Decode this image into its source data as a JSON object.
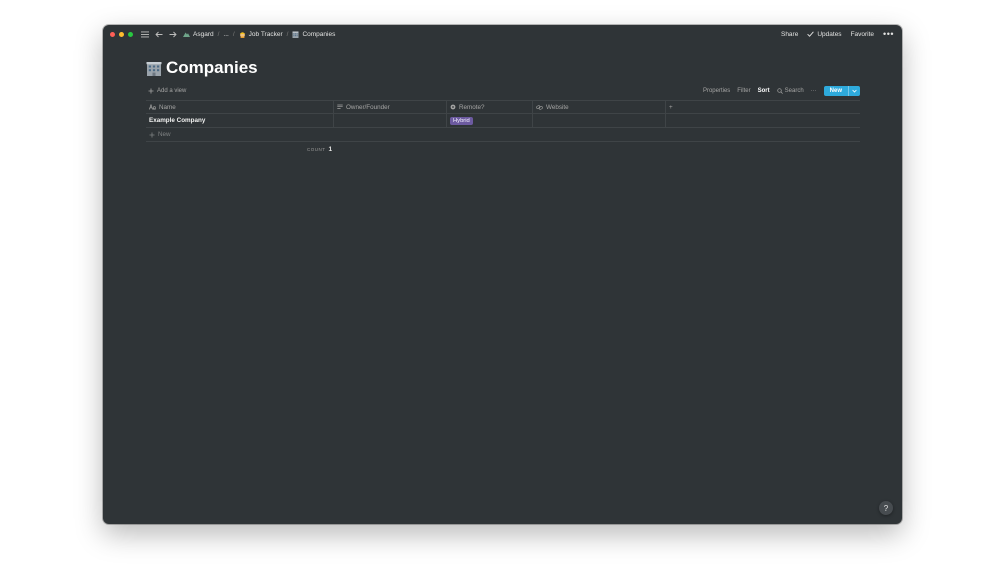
{
  "titlebar": {
    "breadcrumbs": [
      {
        "label": "Asgard",
        "icon": "mountain-icon"
      },
      {
        "label": "...",
        "icon": ""
      },
      {
        "label": "Job Tracker",
        "icon": "worker-emoji-icon"
      },
      {
        "label": "Companies",
        "icon": "office-building-emoji-icon"
      }
    ],
    "separator": "/",
    "share": "Share",
    "updates": "Updates",
    "favorite": "Favorite",
    "more": "•••"
  },
  "page": {
    "title": "Companies",
    "title_icon": "office-building-emoji-icon"
  },
  "viewbar": {
    "add_view": "Add a view",
    "properties": "Properties",
    "filter": "Filter",
    "sort": "Sort",
    "search": "Search",
    "more": "···",
    "new": "New"
  },
  "table": {
    "columns": [
      {
        "label": "Name",
        "icon": "text-aa-icon"
      },
      {
        "label": "Owner/Founder",
        "icon": "list-lines-icon"
      },
      {
        "label": "Remote?",
        "icon": "gear-icon"
      },
      {
        "label": "Website",
        "icon": "link-icon"
      }
    ],
    "add_column": "+",
    "rows": [
      {
        "name": "Example Company",
        "owner": "",
        "remote": "Hybrid",
        "website": ""
      }
    ],
    "new_row": "New",
    "count_label": "COUNT",
    "count_value": "1"
  },
  "colors": {
    "background": "#2f3437",
    "accent": "#2eaadc",
    "tag_hybrid": "#6c5aa0"
  },
  "help": "?"
}
